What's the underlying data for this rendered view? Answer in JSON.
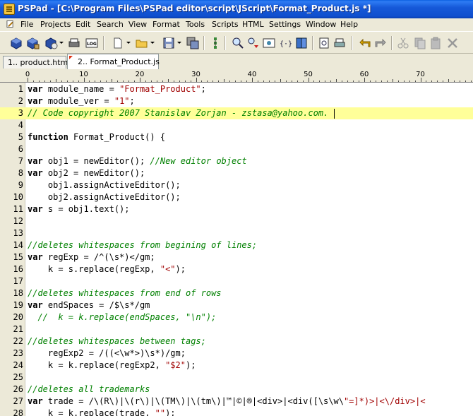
{
  "window": {
    "title": "PSPad - [C:\\Program Files\\PSPad editor\\script\\JScript\\Format_Product.js *]"
  },
  "menu": {
    "items": [
      "File",
      "Projects",
      "Edit",
      "Search",
      "View",
      "Format",
      "Tools",
      "Scripts",
      "HTML",
      "Settings",
      "Window",
      "Help"
    ]
  },
  "toolbar": {
    "buttons": [
      "project-open-icon",
      "project-save-icon",
      "project-recent-icon",
      "print-icon",
      "log-icon",
      "new-file-icon",
      "open-file-icon",
      "save-icon",
      "save-all-icon",
      "copy-window-icon",
      "tree-icon",
      "find-icon",
      "find-replace-icon",
      "preview-icon",
      "code-explorer-icon",
      "book-icon",
      "print-preview-icon",
      "print-button-icon",
      "undo-icon",
      "redo-icon",
      "cut-icon",
      "copy-icon",
      "paste-icon",
      "delete-icon"
    ],
    "log_text": "LOG"
  },
  "tabs": [
    {
      "label": "1.. product.html",
      "active": false
    },
    {
      "label": "2.. Format_Product.js",
      "active": true
    }
  ],
  "ruler": {
    "labels": [
      "0",
      "10",
      "20",
      "30",
      "40",
      "50",
      "60",
      "70"
    ]
  },
  "editor": {
    "current_line": 3,
    "lines": [
      {
        "n": "1",
        "segments": [
          {
            "t": "kw",
            "v": "var"
          },
          {
            "t": "p",
            "v": " module_name = "
          },
          {
            "t": "str",
            "v": "\"Format_Product\""
          },
          {
            "t": "p",
            "v": ";"
          }
        ]
      },
      {
        "n": "2",
        "segments": [
          {
            "t": "kw",
            "v": "var"
          },
          {
            "t": "p",
            "v": " module_ver = "
          },
          {
            "t": "str",
            "v": "\"1\""
          },
          {
            "t": "p",
            "v": ";"
          }
        ]
      },
      {
        "n": "3",
        "segments": [
          {
            "t": "cmt",
            "v": "// Code copyright 2007 Stanislav Zorjan - zstasa@yahoo.com. "
          }
        ]
      },
      {
        "n": "4",
        "segments": []
      },
      {
        "n": "5",
        "segments": [
          {
            "t": "kw",
            "v": "function"
          },
          {
            "t": "p",
            "v": " Format_Product() {"
          }
        ]
      },
      {
        "n": "6",
        "segments": []
      },
      {
        "n": "7",
        "segments": [
          {
            "t": "kw",
            "v": "var"
          },
          {
            "t": "p",
            "v": " obj1 = newEditor(); "
          },
          {
            "t": "cmt",
            "v": "//New editor object"
          }
        ]
      },
      {
        "n": "8",
        "segments": [
          {
            "t": "kw",
            "v": "var"
          },
          {
            "t": "p",
            "v": " obj2 = newEditor();"
          }
        ]
      },
      {
        "n": "9",
        "segments": [
          {
            "t": "p",
            "v": "    obj1.assignActiveEditor();"
          }
        ]
      },
      {
        "n": "10",
        "segments": [
          {
            "t": "p",
            "v": "    obj2.assignActiveEditor();"
          }
        ]
      },
      {
        "n": "11",
        "segments": [
          {
            "t": "kw",
            "v": "var"
          },
          {
            "t": "p",
            "v": " s = obj1.text();"
          }
        ]
      },
      {
        "n": "12",
        "segments": []
      },
      {
        "n": "13",
        "segments": []
      },
      {
        "n": "14",
        "segments": [
          {
            "t": "cmt",
            "v": "//deletes whitespaces from begining of lines;"
          }
        ]
      },
      {
        "n": "15",
        "segments": [
          {
            "t": "kw",
            "v": "var"
          },
          {
            "t": "p",
            "v": " regExp = /^(\\s*)</gm;"
          }
        ]
      },
      {
        "n": "16",
        "segments": [
          {
            "t": "p",
            "v": "    k = s.replace(regExp, "
          },
          {
            "t": "str",
            "v": "\"<\""
          },
          {
            "t": "p",
            "v": ");"
          }
        ]
      },
      {
        "n": "17",
        "segments": []
      },
      {
        "n": "18",
        "segments": [
          {
            "t": "cmt",
            "v": "//deletes whitespaces from end of rows"
          }
        ]
      },
      {
        "n": "19",
        "segments": [
          {
            "t": "kw",
            "v": "var"
          },
          {
            "t": "p",
            "v": " endSpaces = /$\\s*/gm"
          }
        ]
      },
      {
        "n": "20",
        "segments": [
          {
            "t": "cmt",
            "v": "  //  k = k.replace(endSpaces, \"\\n\");"
          }
        ]
      },
      {
        "n": "21",
        "segments": []
      },
      {
        "n": "22",
        "segments": [
          {
            "t": "cmt",
            "v": "//deletes whitespaces between tags;"
          }
        ]
      },
      {
        "n": "23",
        "segments": [
          {
            "t": "p",
            "v": "    regExp2 = /((<\\w*>)\\s*)/gm;"
          }
        ]
      },
      {
        "n": "24",
        "segments": [
          {
            "t": "p",
            "v": "    k = k.replace(regExp2, "
          },
          {
            "t": "str",
            "v": "\"$2\""
          },
          {
            "t": "p",
            "v": ");"
          }
        ]
      },
      {
        "n": "25",
        "segments": []
      },
      {
        "n": "26",
        "segments": [
          {
            "t": "cmt",
            "v": "//deletes all trademarks"
          }
        ]
      },
      {
        "n": "27",
        "segments": [
          {
            "t": "kw",
            "v": "var"
          },
          {
            "t": "p",
            "v": " trade = /\\(R\\)|\\(r\\)|\\(TM\\)|\\(tm\\)|™|©|®|<div>|<div([\\s\\w\\"
          },
          {
            "t": "str",
            "v": "\"=]*)>|<\\/div>|<"
          }
        ]
      },
      {
        "n": "28",
        "segments": [
          {
            "t": "p",
            "v": "    k = k.replace(trade, "
          },
          {
            "t": "str",
            "v": "\"\""
          },
          {
            "t": "p",
            "v": ");"
          }
        ]
      }
    ]
  }
}
